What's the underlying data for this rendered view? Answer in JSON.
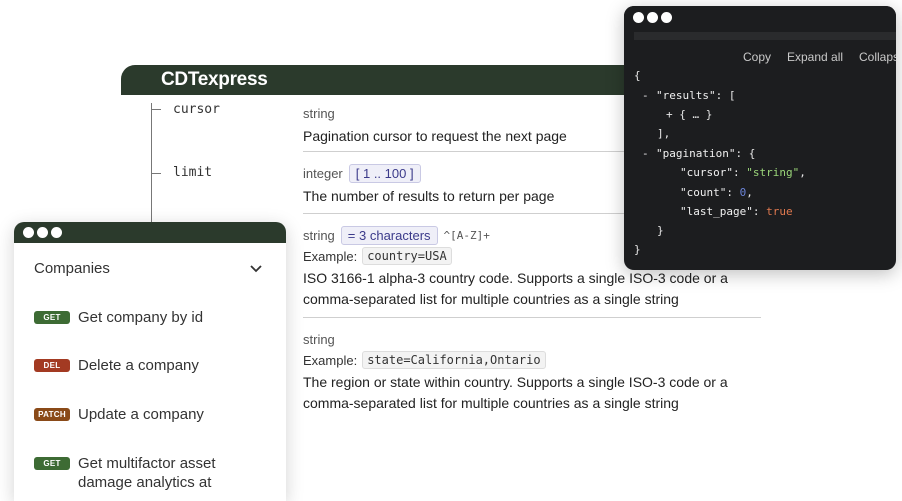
{
  "doc": {
    "title": "CDTexpress",
    "tree": [
      "cursor",
      "limit"
    ],
    "params": [
      {
        "type": "string",
        "description": "Pagination cursor to request the next page"
      },
      {
        "type": "integer",
        "constraint": "[ 1 .. 100 ]",
        "description": "The number of results to return per page"
      },
      {
        "type": "string",
        "constraint": "= 3 characters",
        "pattern": "^[A-Z]+",
        "example_label": "Example:",
        "example": "country=USA",
        "description_1": "ISO 3166-1 alpha-3 country code. Supports a single ISO-3 code or a",
        "description_2": "comma-separated list for multiple countries as a single string"
      },
      {
        "type": "string",
        "example_label": "Example:",
        "example": "state=California,Ontario",
        "description_1": "The region or state within country. Supports a single ISO-3 code or a",
        "description_2": "comma-separated list for multiple countries as a single string"
      }
    ]
  },
  "sidebar": {
    "heading": "Companies",
    "items": [
      {
        "method": "GET",
        "method_color": "#3d6b34",
        "label": "Get company by id"
      },
      {
        "method": "DEL",
        "method_color": "#a33a22",
        "label": "Delete a company"
      },
      {
        "method": "PATCH",
        "method_color": "#8a4a18",
        "label": "Update a company"
      },
      {
        "method": "GET",
        "method_color": "#3d6b34",
        "label": "Get multifactor asset damage analytics at"
      }
    ]
  },
  "code": {
    "copy": "Copy",
    "expand_all": "Expand all",
    "collapse": "Collaps",
    "lines": {
      "l1": "{",
      "l2_minus": "-",
      "l2_key": "\"results\"",
      "l2_rest": ": [",
      "l3": "+ { … }",
      "l4": "],",
      "l5_minus": "-",
      "l5_key": "\"pagination\"",
      "l5_rest": ": {",
      "l6_key": "\"cursor\"",
      "l6_val": "\"string\"",
      "l7_key": "\"count\"",
      "l7_val": "0",
      "l8_key": "\"last_page\"",
      "l8_val": "true",
      "l9": "}",
      "l10": "}"
    }
  },
  "colors": {
    "header": "#2b3a2c",
    "code_bg": "#1c1d1f",
    "string": "#9bd67a",
    "number": "#6b84d9",
    "boolean": "#e0794f"
  }
}
